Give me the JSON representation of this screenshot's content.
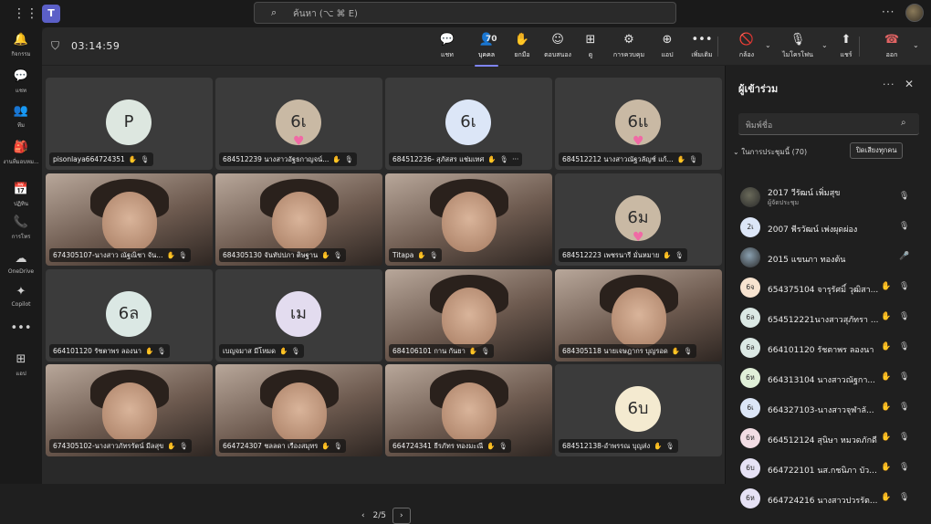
{
  "topbar": {
    "search_placeholder": "ค้นหา (⌥ ⌘ E)"
  },
  "rail": [
    {
      "icon": "bell-icon",
      "glyph": "🔔",
      "label": "กิจกรรม"
    },
    {
      "icon": "chat-icon",
      "glyph": "💬",
      "label": "แชท"
    },
    {
      "icon": "teams-icon",
      "glyph": "👥",
      "label": "ทีม"
    },
    {
      "icon": "assignments-icon",
      "glyph": "🎒",
      "label": "งานที่มอบหม..."
    },
    {
      "icon": "calendar-icon",
      "glyph": "📅",
      "label": "ปฏิทิน"
    },
    {
      "icon": "calls-icon",
      "glyph": "📞",
      "label": "การโทร"
    },
    {
      "icon": "onedrive-icon",
      "glyph": "☁",
      "label": "OneDrive"
    },
    {
      "icon": "copilot-icon",
      "glyph": "✦",
      "label": "Copilot"
    },
    {
      "icon": "more-icon",
      "glyph": "•••",
      "label": ""
    },
    {
      "icon": "apps-icon",
      "glyph": "⊞",
      "label": "แอป"
    }
  ],
  "meeting": {
    "timer": "03:14:59",
    "toolbar": [
      {
        "id": "chat",
        "icon": "chat-icon",
        "glyph": "💬",
        "label": "แชท"
      },
      {
        "id": "people",
        "icon": "people-icon",
        "glyph": "👤",
        "label": "บุคคล",
        "count": "70"
      },
      {
        "id": "raise",
        "icon": "raise-hand-icon",
        "glyph": "✋",
        "label": "ยกมือ"
      },
      {
        "id": "react",
        "icon": "smiley-icon",
        "glyph": "☺",
        "label": "ตอบสนอง"
      },
      {
        "id": "view",
        "icon": "grid-view-icon",
        "glyph": "⊞",
        "label": "ดู"
      },
      {
        "id": "rooms",
        "icon": "rooms-icon",
        "glyph": "⚙",
        "label": "การควบคุม"
      },
      {
        "id": "apps",
        "icon": "add-app-icon",
        "glyph": "⊕",
        "label": "แอป"
      },
      {
        "id": "more",
        "icon": "more-icon",
        "glyph": "•••",
        "label": "เพิ่มเติม"
      },
      {
        "id": "camera",
        "icon": "camera-off-icon",
        "glyph": "🚫",
        "label": "กล้อง"
      },
      {
        "id": "mic",
        "icon": "mic-off-icon",
        "glyph": "🎙",
        "label": "ไมโครโฟน"
      },
      {
        "id": "share",
        "icon": "share-icon",
        "glyph": "⬆",
        "label": "แชร์"
      },
      {
        "id": "leave",
        "icon": "hang-up-icon",
        "glyph": "☎",
        "label": "ออก"
      }
    ],
    "tiles": [
      {
        "name": "pisonlaya664724351",
        "initials": "P",
        "avatar_color": "#dde7e0",
        "kind": "avatar"
      },
      {
        "name": "684512239 นางสาวอัฐธกาญจน์...",
        "initials": "6เ",
        "avatar_color": "#c9b9a4",
        "kind": "avatar",
        "heart": true
      },
      {
        "name": "684512236- สุภัสสร แช่มเทศ",
        "initials": "6เ",
        "avatar_color": "#dce6f7",
        "kind": "avatar",
        "more": "···"
      },
      {
        "name": "684512212 นางสาวณัฐวลัญช์ แก้...",
        "initials": "6แ",
        "avatar_color": "#c9b9a4",
        "kind": "avatar",
        "heart": true
      },
      {
        "name": "674305107-นางสาว ณัฐณิชา จัน...",
        "kind": "video"
      },
      {
        "name": "684305130 จันทัปปภา ติษฐาน",
        "kind": "video"
      },
      {
        "name": "Titapa",
        "kind": "video"
      },
      {
        "name": "684512223 เพชรนารี มั่นหมาย",
        "initials": "6ม",
        "avatar_color": "#c9b9a4",
        "kind": "avatar",
        "heart": true
      },
      {
        "name": "664101120 รัชตาพร ลองนา",
        "initials": "6ล",
        "avatar_color": "#dbe8e4",
        "kind": "avatar"
      },
      {
        "name": "เบญจมาส มีโหมด",
        "initials": "เม",
        "avatar_color": "#e3dcef",
        "kind": "avatar"
      },
      {
        "name": "684106101 กาน กันยา",
        "kind": "video"
      },
      {
        "name": "684305118 นายเจษฎากร บุญรอด",
        "kind": "video"
      },
      {
        "name": "674305102-นางสาวภัทรรัตน์ มีลสุข",
        "kind": "video"
      },
      {
        "name": "664724307 ชลลดา เรืองสมุทร",
        "kind": "video"
      },
      {
        "name": "664724341 ธีรภัทร ทองมะณี",
        "kind": "video"
      },
      {
        "name": "684512138-อำพรรณ บุญส่ง",
        "initials": "6บ",
        "avatar_color": "#f4ead0",
        "kind": "avatar"
      }
    ],
    "pager": {
      "label": "2/5"
    }
  },
  "panel": {
    "title": "ผู้เข้าร่วม",
    "search_placeholder": "พิมพ์ชื่อ",
    "section_label": "ในการประชุมนี้ (70)",
    "mute_all": "ปิดเสียงทุกคน",
    "participants": [
      {
        "name": "2017 วีรัฒน์ เพิ่มสุข",
        "role": "ผู้จัดประชุม",
        "initials": "",
        "avatar_color": "#6a6a5a",
        "photo": true,
        "mic": "muted"
      },
      {
        "name": "2007 พีรวัฒน์ เพ่งผุดผ่อง",
        "initials": "2เ",
        "avatar_color": "#dce6f7",
        "mic": "muted"
      },
      {
        "name": "2015 แขนภา ทองต้น",
        "initials": "",
        "avatar_color": "#8aa0b0",
        "photo": true,
        "mic": "on"
      },
      {
        "name": "654375104 จารุรัศมิ์ วุฒิสา...",
        "initials": "6จ",
        "avatar_color": "#f7e3cf",
        "hand": true,
        "mic": "muted"
      },
      {
        "name": "654512221นางสาวสุภัทรา ...",
        "initials": "6ล",
        "avatar_color": "#dbe8e4",
        "hand": true,
        "mic": "muted"
      },
      {
        "name": "664101120 รัชตาพร ลองนา",
        "initials": "6ล",
        "avatar_color": "#dbe8e4",
        "hand": true,
        "mic": "muted"
      },
      {
        "name": "664313104 นางสาวณัฐกา...",
        "initials": "6ห",
        "avatar_color": "#e0efd8",
        "hand": true,
        "mic": "muted"
      },
      {
        "name": "664327103-นางสาวจุฬาลั...",
        "initials": "6เ",
        "avatar_color": "#dce6f7",
        "hand": true,
        "mic": "muted"
      },
      {
        "name": "664512124 สุนิษา หมวดภักดี",
        "initials": "6ห",
        "avatar_color": "#f2dde4",
        "hand": true,
        "mic": "muted"
      },
      {
        "name": "664722101 นส.กชนิภา บัว...",
        "initials": "6บ",
        "avatar_color": "#e6e2f5",
        "hand": true,
        "mic": "muted"
      },
      {
        "name": "664724216 นางสาวปวรรัต...",
        "initials": "6ห",
        "avatar_color": "#e6e2f5",
        "hand": true,
        "mic": "muted"
      }
    ]
  }
}
